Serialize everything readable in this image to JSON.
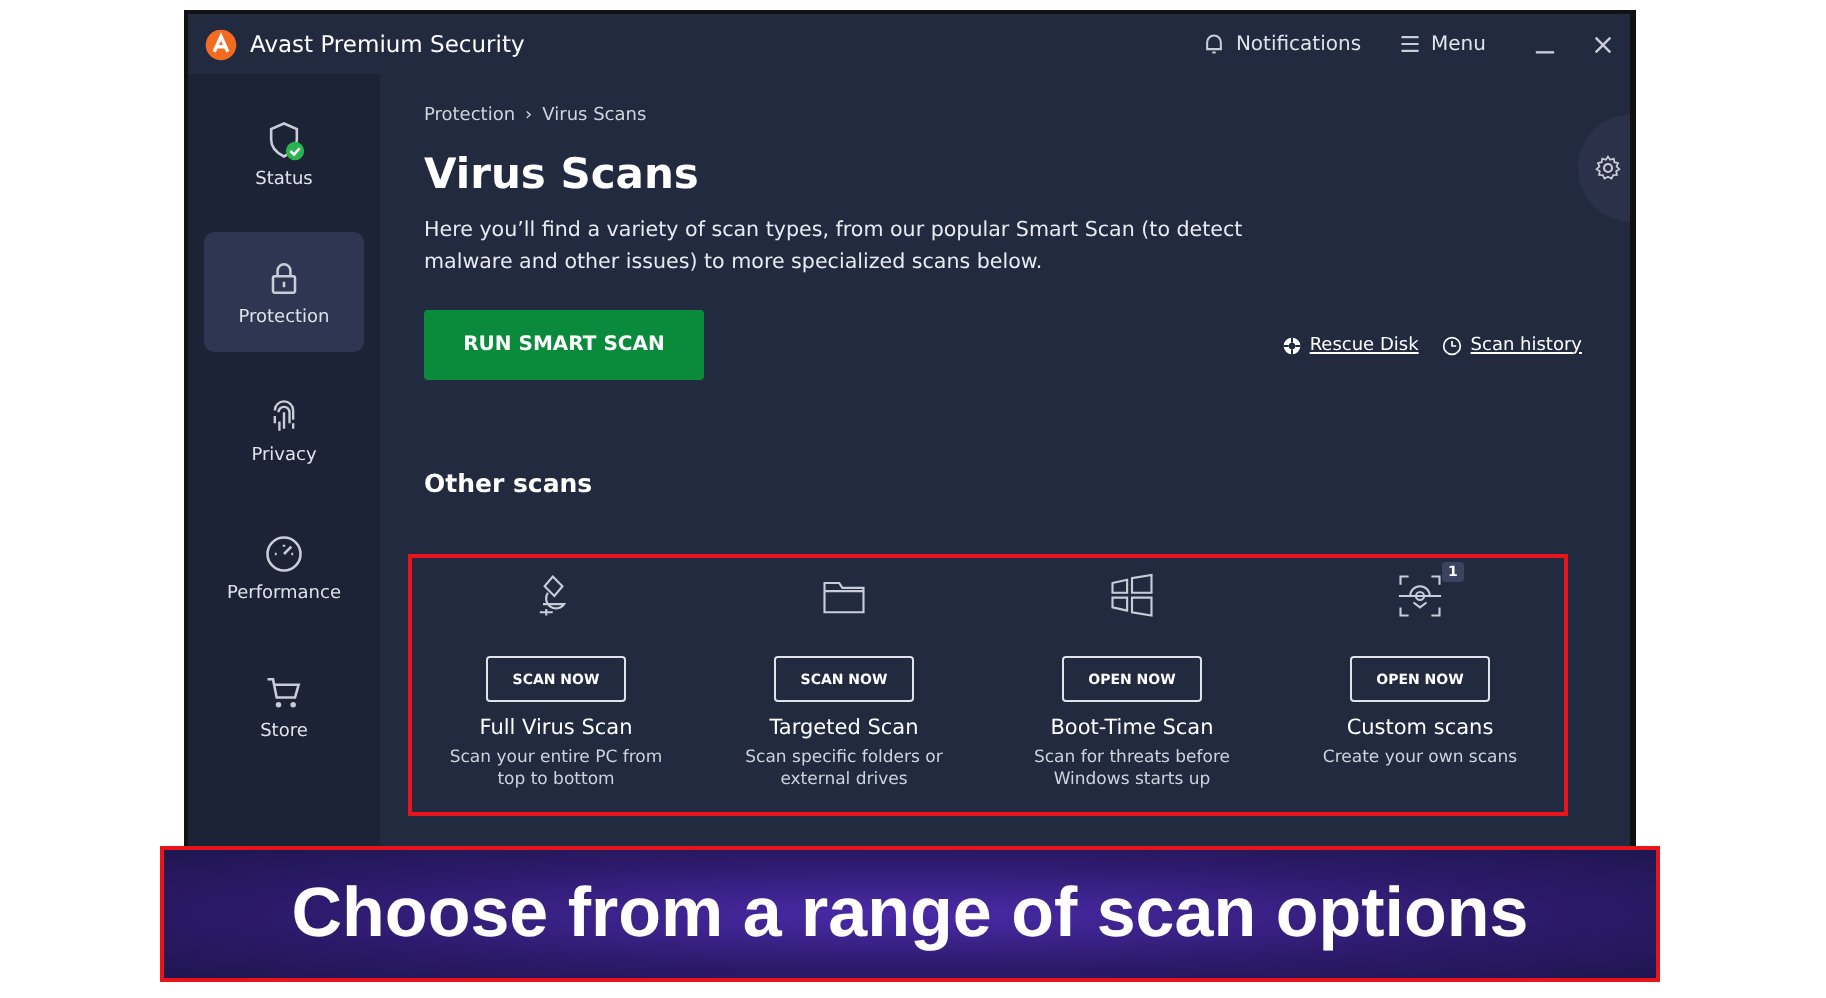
{
  "window": {
    "title": "Avast Premium Security",
    "actions": [
      {
        "kind": "notifications",
        "label": "Notifications"
      },
      {
        "kind": "menu",
        "label": "Menu"
      }
    ]
  },
  "sidebar": {
    "items": [
      {
        "kind": "status",
        "label": "Status",
        "selected": false
      },
      {
        "kind": "protection",
        "label": "Protection",
        "selected": true
      },
      {
        "kind": "privacy",
        "label": "Privacy",
        "selected": false
      },
      {
        "kind": "performance",
        "label": "Performance",
        "selected": false
      },
      {
        "kind": "store",
        "label": "Store",
        "selected": false
      }
    ]
  },
  "breadcrumb": [
    "Protection",
    "Virus Scans"
  ],
  "breadcrumb_separator": "›",
  "heading": "Virus Scans",
  "description": "Here you’ll find a variety of scan types, from our popular Smart Scan (to detect malware and other issues) to more specialized scans below.",
  "primary_button": "RUN SMART SCAN",
  "links": [
    {
      "kind": "rescue",
      "label": "Rescue Disk"
    },
    {
      "kind": "history",
      "label": "Scan history"
    }
  ],
  "section_title": "Other scans",
  "scans": [
    {
      "kind": "full",
      "button": "SCAN NOW",
      "title": "Full Virus Scan",
      "description": "Scan your entire PC from top to bottom"
    },
    {
      "kind": "targeted",
      "button": "SCAN NOW",
      "title": "Targeted Scan",
      "description": "Scan specific folders or external drives"
    },
    {
      "kind": "boot",
      "button": "OPEN NOW",
      "title": "Boot-Time Scan",
      "description": "Scan for threats before Windows starts up"
    },
    {
      "kind": "custom",
      "button": "OPEN NOW",
      "title": "Custom scans",
      "description": "Create your own scans",
      "badge": "1"
    }
  ],
  "caption": "Choose from a range of scan options"
}
